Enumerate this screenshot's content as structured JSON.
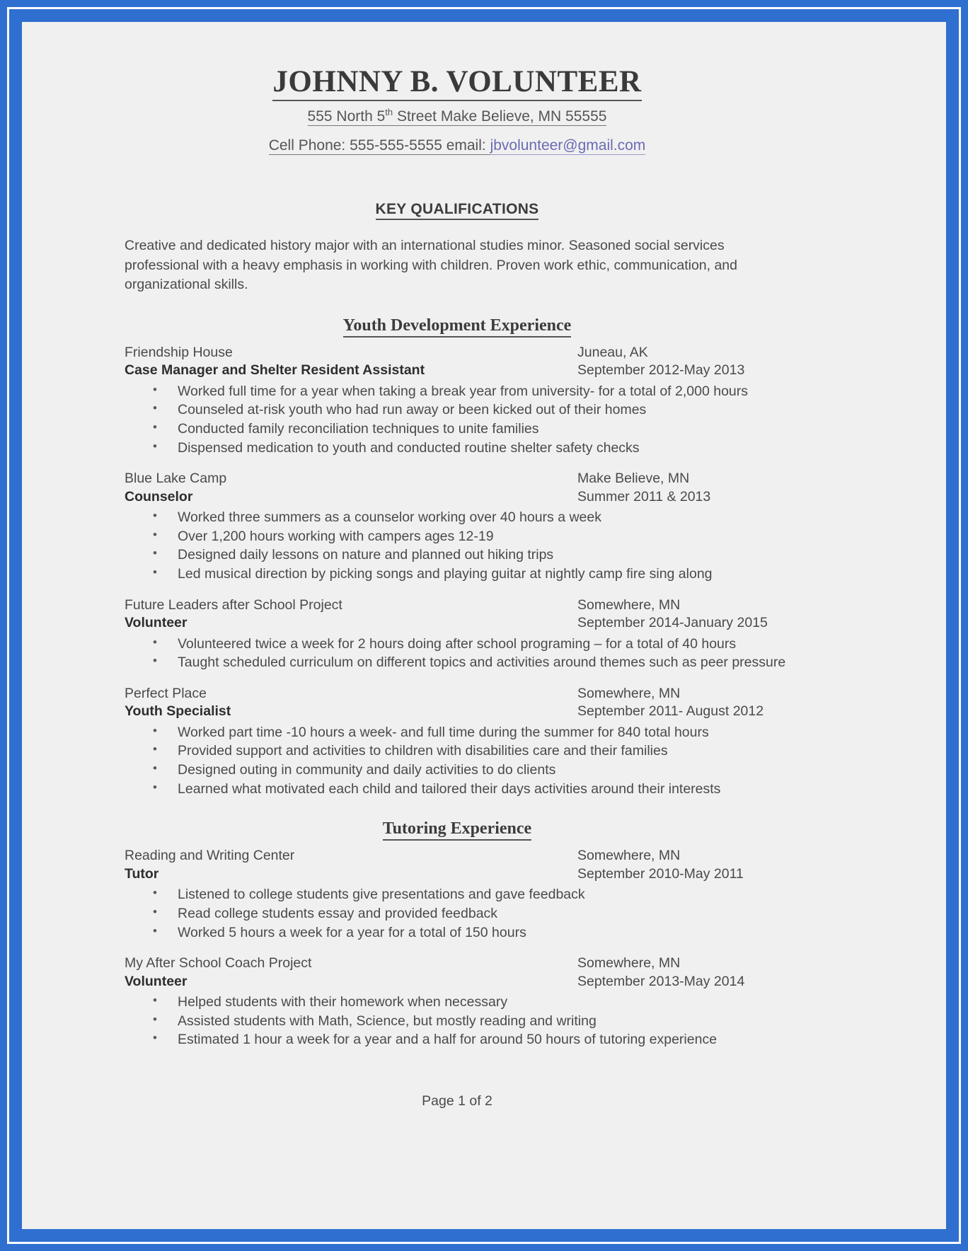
{
  "document": {
    "name": "JOHNNY B. VOLUNTEER",
    "address": "555 North 5",
    "address_sup": "th",
    "address_rest": " Street Make Believe, MN 55555",
    "contact_prefix": "Cell Phone: 555-555-5555 email: ",
    "email": "jbvolunteer@gmail.com",
    "footer": "Page 1 of 2",
    "colors": {
      "scan_border": "#2f6fd0",
      "page_background": "#f0f0f0",
      "body_text": "#4a4a4a",
      "heading_text": "#3c3c3c",
      "email_link": "#6b6bb5"
    }
  },
  "key_qualifications": {
    "heading": "KEY QUALIFICATIONS",
    "summary": "Creative and dedicated history major with an international studies minor. Seasoned social services professional with a heavy emphasis in working with children. Proven work ethic, communication, and organizational skills."
  },
  "sections": [
    {
      "heading": "Youth Development Experience",
      "jobs": [
        {
          "organization": "Friendship House",
          "location": "Juneau, AK",
          "title": "Case Manager and Shelter Resident Assistant",
          "dates": "September 2012-May 2013",
          "bullets": [
            "Worked full time for a year when taking a break year from university- for a total of 2,000 hours",
            "Counseled at-risk youth who had run away or been kicked out of their homes",
            "Conducted family reconciliation techniques to unite families",
            "Dispensed medication to youth and conducted routine shelter safety checks"
          ]
        },
        {
          "organization": "Blue Lake Camp",
          "location": "Make Believe, MN",
          "title": "Counselor",
          "dates": "Summer 2011 & 2013",
          "bullets": [
            "Worked three summers as a counselor working over 40 hours a week",
            "Over 1,200 hours working with campers ages 12-19",
            "Designed daily lessons on nature and planned out hiking trips",
            "Led musical direction by picking songs and playing guitar at nightly camp fire sing along"
          ]
        },
        {
          "organization": "Future Leaders after School Project",
          "location": "Somewhere, MN",
          "title": "Volunteer",
          "dates": "September 2014-January 2015",
          "bullets": [
            "Volunteered twice a week for 2 hours doing after school programing – for a total of 40 hours",
            "Taught scheduled curriculum on different topics and activities around themes such as peer pressure"
          ]
        },
        {
          "organization": "Perfect Place",
          "location": "Somewhere, MN",
          "title": "Youth Specialist",
          "dates": "September 2011- August 2012",
          "bullets": [
            "Worked part time -10 hours a week- and full time during the summer for 840 total hours",
            "Provided support and activities to children with disabilities care and their families",
            "Designed outing in community and daily activities to do clients",
            "Learned what motivated each child and tailored their days activities around their interests"
          ]
        }
      ]
    },
    {
      "heading": "Tutoring Experience",
      "jobs": [
        {
          "organization": "Reading and Writing Center",
          "location": "Somewhere, MN",
          "title": "Tutor",
          "dates": "September 2010-May 2011",
          "bullets": [
            "Listened to college students give presentations and gave feedback",
            "Read college students essay and provided feedback",
            "Worked 5 hours a week for a year for a total of 150 hours"
          ]
        },
        {
          "organization": "My After School Coach Project",
          "location": "Somewhere, MN",
          "title": "Volunteer",
          "dates": "September 2013-May 2014",
          "bullets": [
            "Helped students with their homework when necessary",
            "Assisted students with Math, Science, but mostly reading and writing",
            "Estimated 1 hour a week for a year and a half for around 50 hours of tutoring experience"
          ]
        }
      ]
    }
  ]
}
